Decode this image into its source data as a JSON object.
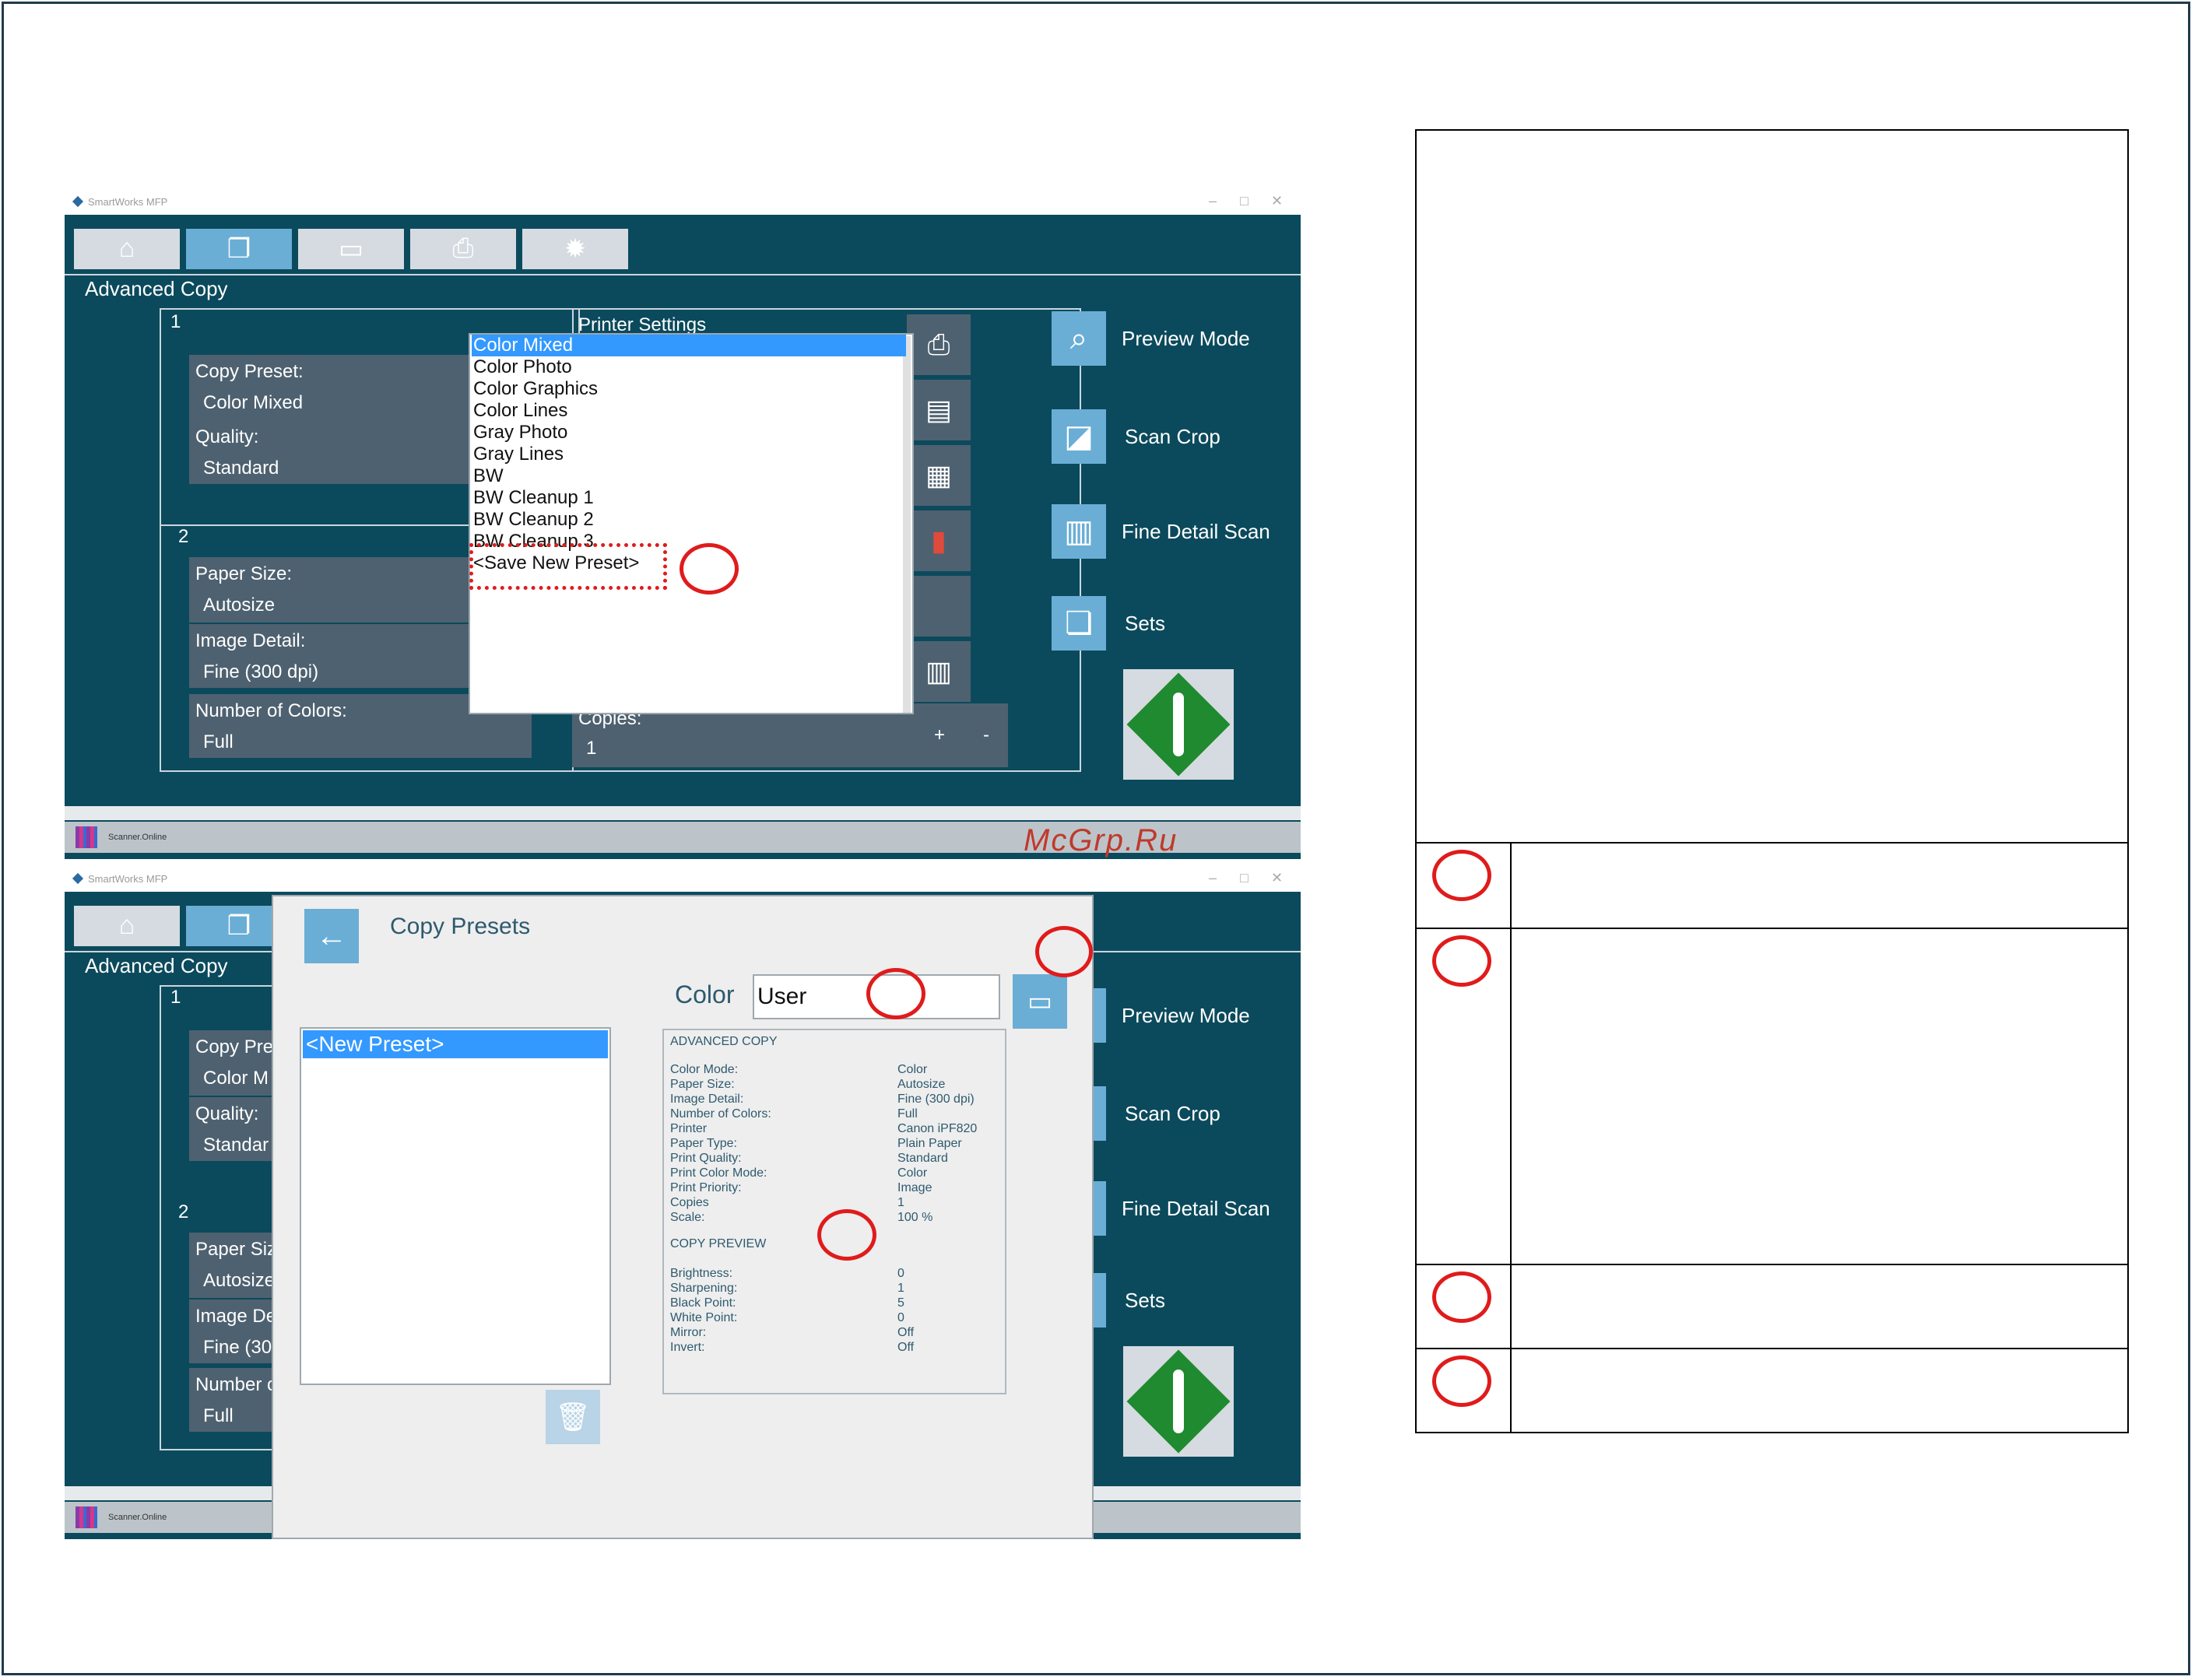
{
  "app": {
    "title": "SmartWorks MFP",
    "section_title": "Advanced Copy",
    "status_text": "Scanner.Online"
  },
  "nav_tabs": [
    {
      "icon": "home-icon",
      "glyph": "⌂"
    },
    {
      "icon": "copy-icon",
      "glyph": "❐"
    },
    {
      "icon": "scanner-icon",
      "glyph": "▭"
    },
    {
      "icon": "printer-icon",
      "glyph": "⎙"
    },
    {
      "icon": "gear-icon",
      "glyph": "✹"
    }
  ],
  "panel": {
    "group1_num": "1",
    "group2_num": "2",
    "copy_preset_label": "Copy Preset:",
    "copy_preset_value": "Color Mixed",
    "quality_label": "Quality:",
    "quality_value": "Standard",
    "paper_size_label": "Paper Size:",
    "paper_size_value": "Autosize",
    "image_detail_label": "Image Detail:",
    "image_detail_value": "Fine (300 dpi)",
    "num_colors_label": "Number of Colors:",
    "num_colors_value": "Full",
    "printer_settings_label": "Printer Settings",
    "copies_label": "Copies:",
    "copies_value": "1",
    "plus": "+",
    "minus": "-"
  },
  "bottom_panel_partial": {
    "copy_preset_label": "Copy Pre",
    "copy_preset_value": "Color M",
    "quality_value": "Standar",
    "paper_size_label": "Paper Siz",
    "paper_size_value": "Autosize",
    "image_detail_label": "Image De",
    "image_detail_value": "Fine (30",
    "num_colors_label": "Number c"
  },
  "preset_dropdown": {
    "items": [
      "Color Mixed",
      "Color Photo",
      "Color Graphics",
      "Color Lines",
      "Gray Photo",
      "Gray Lines",
      "BW",
      "BW Cleanup 1",
      "BW Cleanup 2",
      "BW Cleanup 3",
      "<Save New Preset>"
    ]
  },
  "side_buttons": {
    "preview": "Preview Mode",
    "scan_crop": "Scan Crop",
    "fine_detail": "Fine Detail Scan",
    "sets": "Sets"
  },
  "dialog": {
    "title": "Copy Presets",
    "name_label": "Color",
    "name_value": "User",
    "list_item": "<New Preset>",
    "summary": {
      "advanced_heading": "ADVANCED COPY",
      "rows": [
        {
          "k": "Color Mode:",
          "v": "Color"
        },
        {
          "k": "Paper Size:",
          "v": "Autosize"
        },
        {
          "k": "Image Detail:",
          "v": "Fine (300 dpi)"
        },
        {
          "k": "Number of Colors:",
          "v": "Full"
        },
        {
          "k": "Printer",
          "v": "Canon iPF820"
        },
        {
          "k": "Paper Type:",
          "v": "Plain Paper"
        },
        {
          "k": "Print Quality:",
          "v": "Standard"
        },
        {
          "k": "Print Color Mode:",
          "v": "Color"
        },
        {
          "k": "Print Priority:",
          "v": "Image"
        },
        {
          "k": "Copies",
          "v": "1"
        },
        {
          "k": "Scale:",
          "v": "100 %"
        }
      ],
      "preview_heading": "COPY PREVIEW",
      "preview_rows": [
        {
          "k": "Brightness:",
          "v": "0"
        },
        {
          "k": "Sharpening:",
          "v": "1"
        },
        {
          "k": "Black Point:",
          "v": "5"
        },
        {
          "k": "White Point:",
          "v": "0"
        },
        {
          "k": "Mirror:",
          "v": "Off"
        },
        {
          "k": "Invert:",
          "v": "Off"
        }
      ]
    }
  },
  "watermark": "McGrp.Ru",
  "colors": {
    "app_bg": "#0b4a5c",
    "accent": "#6aaed6",
    "selection": "#3399ff",
    "callout": "#e01b1b",
    "start": "#1f8a2f"
  }
}
